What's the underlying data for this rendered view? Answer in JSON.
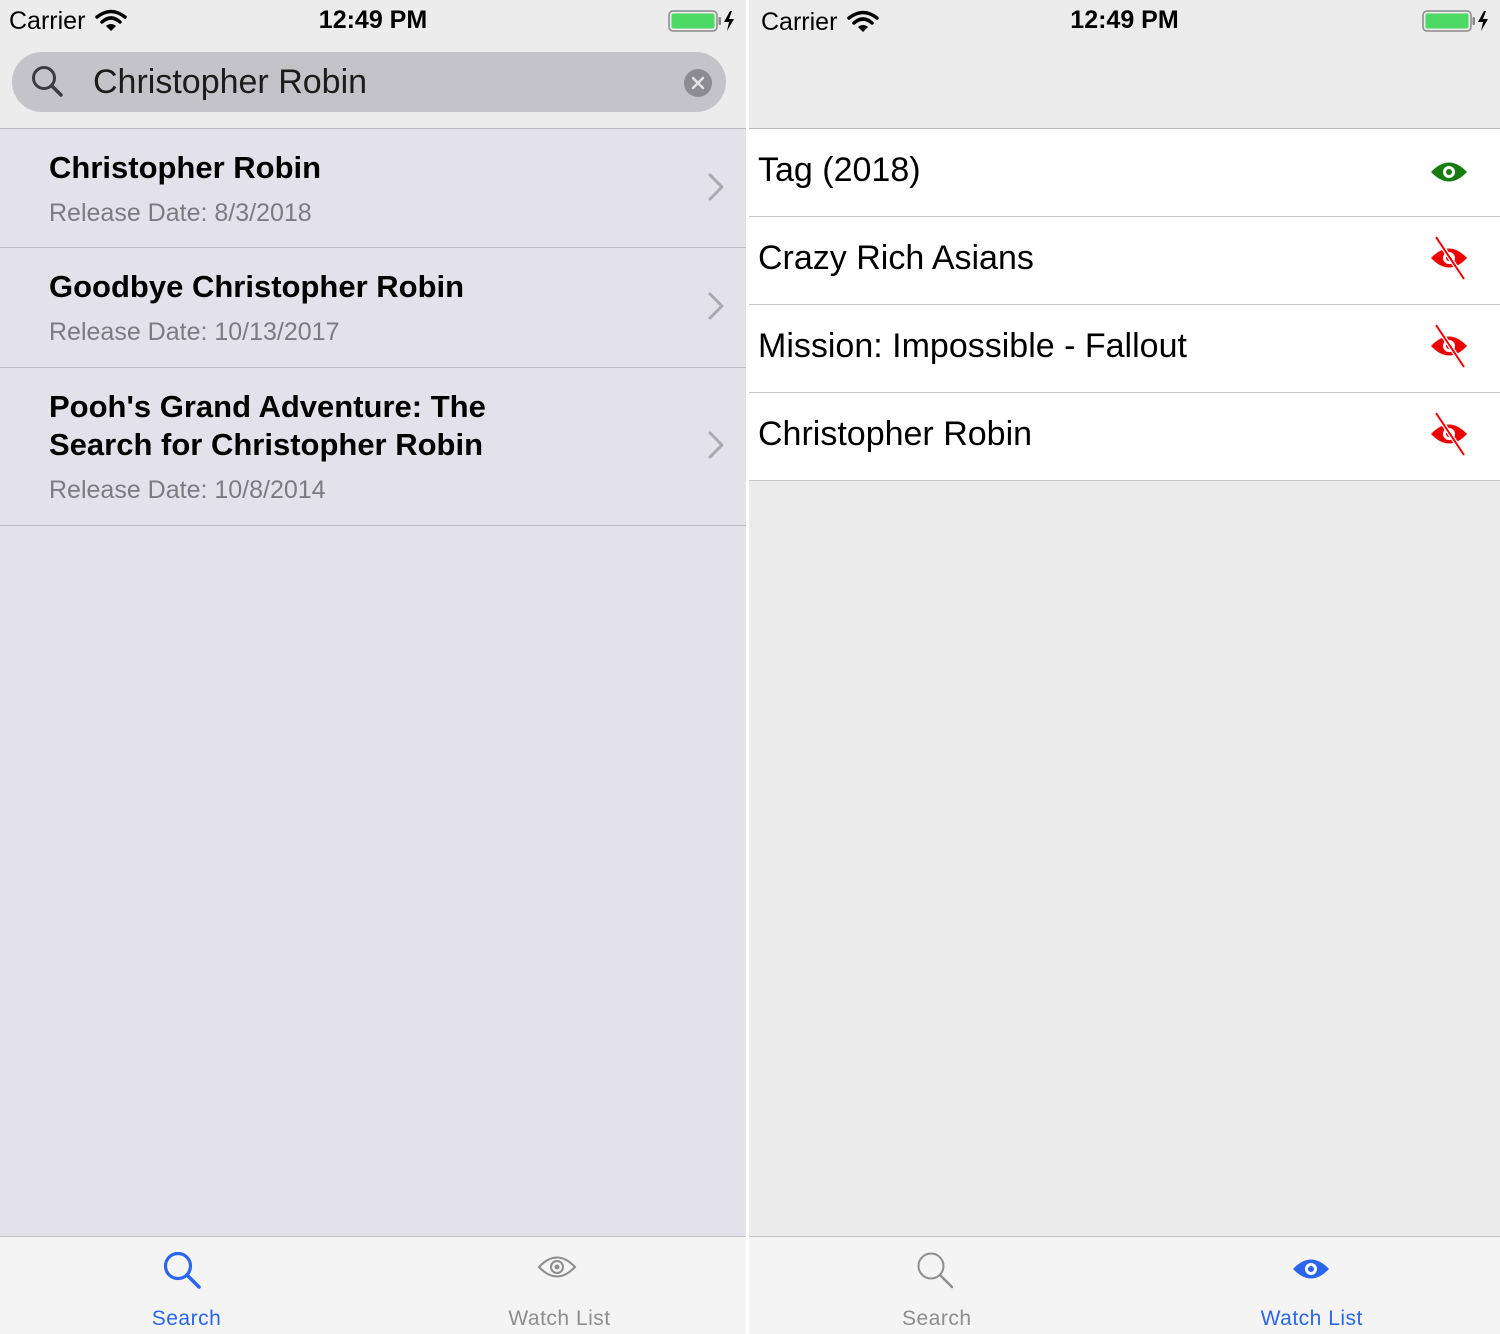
{
  "status_bar": {
    "carrier": "Carrier",
    "time": "12:49 PM",
    "battery_color": "#4cd964"
  },
  "search_screen": {
    "search_query": "Christopher Robin",
    "results": [
      {
        "title": "Christopher Robin",
        "release_date": "Release Date: 8/3/2018"
      },
      {
        "title": "Goodbye Christopher Robin",
        "release_date": "Release Date: 10/13/2017"
      },
      {
        "title": "Pooh's Grand Adventure: The Search for Christopher Robin",
        "release_date": "Release Date: 10/8/2014"
      }
    ],
    "tabs": [
      {
        "label": "Search",
        "icon": "search-icon",
        "active": true
      },
      {
        "label": "Watch List",
        "icon": "eye-outline-icon",
        "active": false
      }
    ]
  },
  "watchlist_screen": {
    "items": [
      {
        "title": "Tag (2018)",
        "watched": true,
        "icon": "eye-icon",
        "icon_color": "#187c10"
      },
      {
        "title": "Crazy Rich Asians",
        "watched": false,
        "icon": "eye-slash-icon",
        "icon_color": "#ee0000"
      },
      {
        "title": "Mission: Impossible - Fallout",
        "watched": false,
        "icon": "eye-slash-icon",
        "icon_color": "#ee0000"
      },
      {
        "title": "Christopher Robin",
        "watched": false,
        "icon": "eye-slash-icon",
        "icon_color": "#ee0000"
      }
    ],
    "tabs": [
      {
        "label": "Search",
        "icon": "search-icon",
        "active": false
      },
      {
        "label": "Watch List",
        "icon": "eye-icon",
        "active": true
      }
    ]
  },
  "colors": {
    "tint": "#2c66ee",
    "tab_inactive": "#8d8d8d"
  }
}
